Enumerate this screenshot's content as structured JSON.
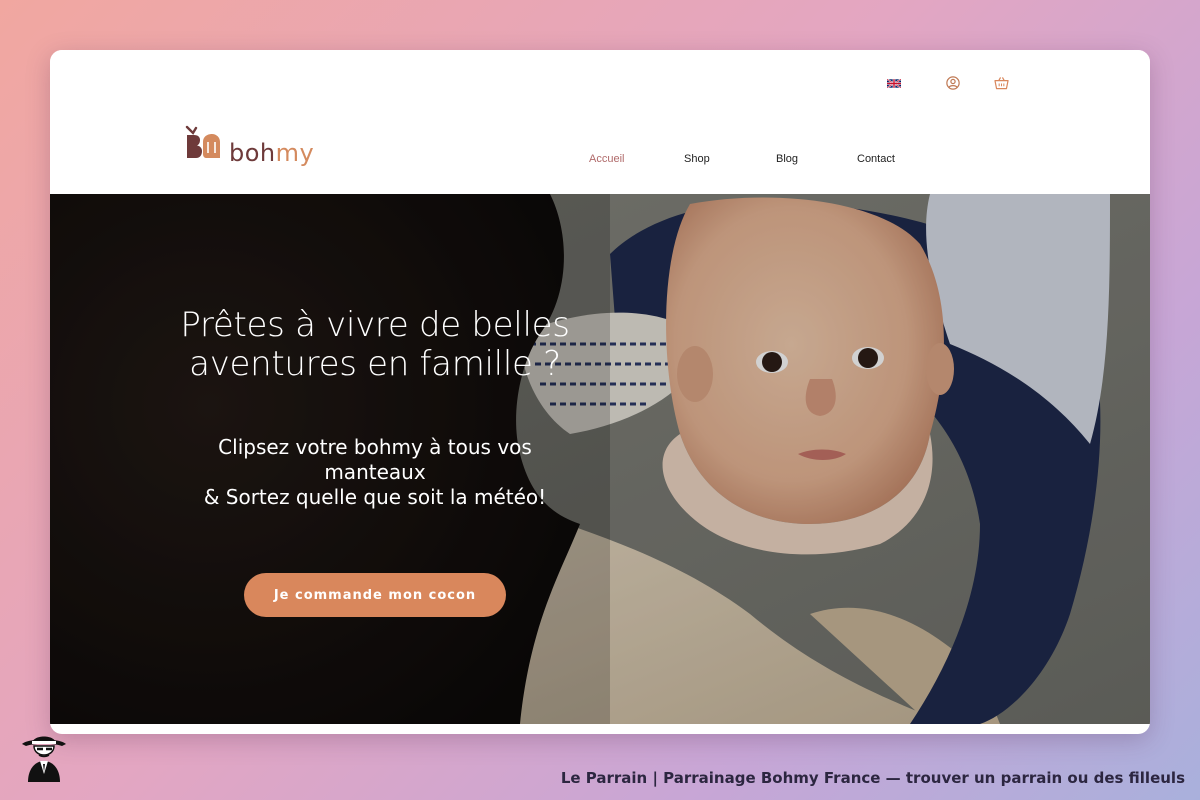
{
  "header": {
    "language_flag": "uk-flag-icon",
    "account_icon": "user-circle-icon",
    "cart_icon": "basket-icon",
    "logo": {
      "text_main": "boh",
      "text_accent": "my"
    }
  },
  "nav": {
    "items": [
      {
        "label": "Accueil",
        "active": true
      },
      {
        "label": "Shop"
      },
      {
        "label": "Blog"
      },
      {
        "label": "Contact"
      }
    ]
  },
  "hero": {
    "title": "Prêtes à vivre de belles aventures en famille ?",
    "subtitle_line1": "Clipsez votre bohmy à tous vos manteaux",
    "subtitle_line2": "& Sortez quelle que soit la météo!",
    "cta_label": "Je commande mon cocon"
  },
  "footer": {
    "title": "Le Parrain | Parrainage Bohmy France — trouver un parrain ou des filleuls"
  },
  "colors": {
    "accent": "#d9875c",
    "nav_active": "#b06a6a",
    "logo_brown": "#6e3a3a",
    "footer_text": "#2c2640"
  }
}
